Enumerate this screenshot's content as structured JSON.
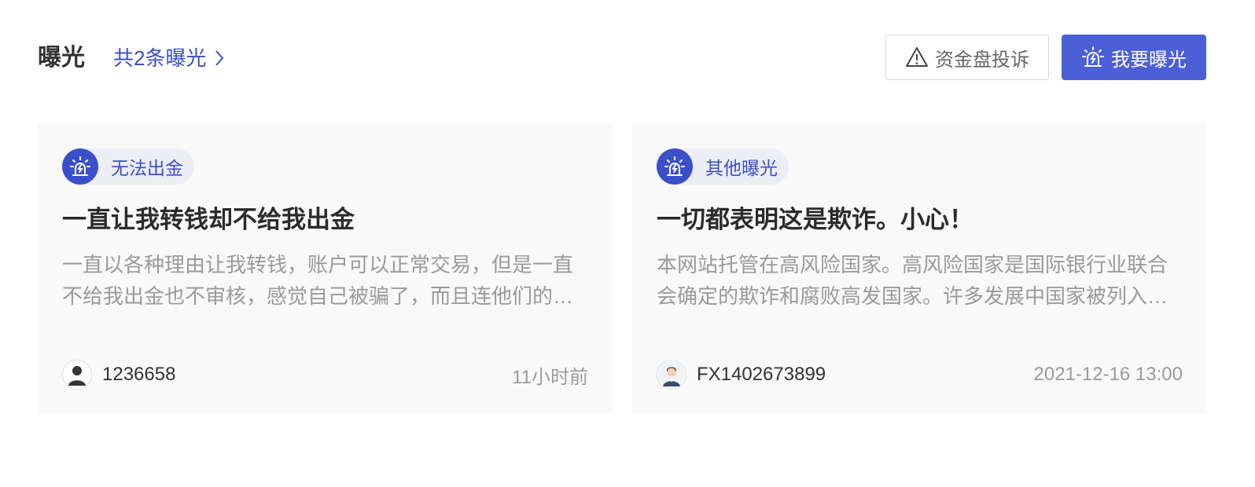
{
  "header": {
    "title": "曝光",
    "total_link": "共2条曝光",
    "complaint_button": "资金盘投诉",
    "expose_button": "我要曝光"
  },
  "cards": [
    {
      "tag": "无法出金",
      "title": "一直让我转钱却不给我出金",
      "description": "一直以各种理由让我转钱，账户可以正常交易，但是一直不给我出金也不审核，感觉自己被骗了，而且连他们的客服都联系不上",
      "user": "1236658",
      "time": "11小时前"
    },
    {
      "tag": "其他曝光",
      "title": "一切都表明这是欺诈。小心！",
      "description": "本网站托管在高风险国家。高风险国家是国际银行业联合会确定的欺诈和腐败高发国家。许多发展中国家被列入高风险名单",
      "user": "FX1402673899",
      "time": "2021-12-16 13:00"
    }
  ],
  "colors": {
    "accent": "#3b4fc9",
    "button_primary": "#4b5fd6",
    "card_background": "#f9f9fa",
    "muted_text": "#9a9a9a"
  },
  "icons": {
    "total_link": "chevron-right-icon",
    "complaint_button": "warning-triangle-icon",
    "expose_button": "alarm-light-icon",
    "tag": "alarm-light-icon",
    "avatar": "user-avatar-icon"
  }
}
